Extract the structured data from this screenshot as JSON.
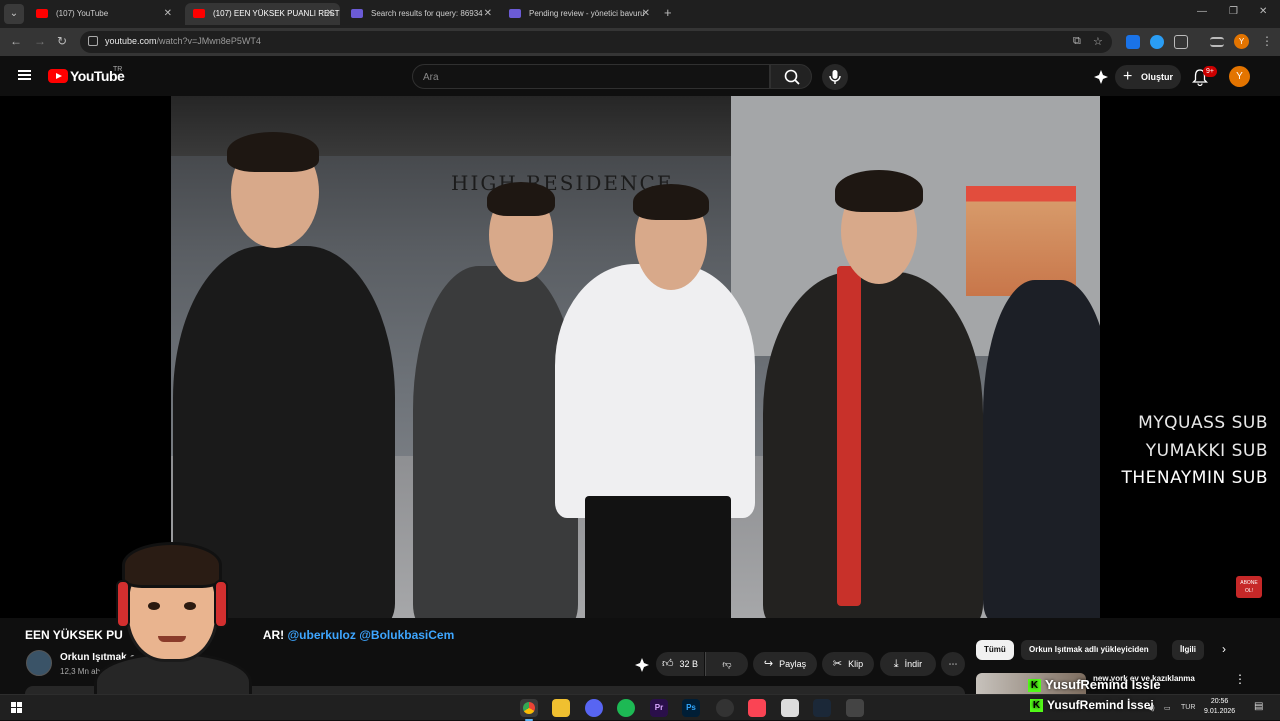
{
  "browser": {
    "tabs": [
      {
        "title": "(107) YouTube",
        "favicon": "youtube-icon",
        "active": false
      },
      {
        "title": "(107) EEN YÜKSEK PUANLI REST",
        "favicon": "youtube-icon",
        "active": true
      },
      {
        "title": "Search results for query: 86934",
        "favicon": "extension-icon",
        "active": false
      },
      {
        "title": "Pending review - yönetici bavuru",
        "favicon": "extension-icon",
        "active": false
      }
    ],
    "new_tab_label": "+",
    "url_host": "youtube.com",
    "url_path": "/watch?v=JMwn8eP5WT4"
  },
  "youtube": {
    "logo_text": "YouTube",
    "region": "TR",
    "search_placeholder": "Ara",
    "create_label": "Oluştur",
    "notifications_badge": "9+",
    "avatar_letter": "Y"
  },
  "player": {
    "ticker": [
      "MYQUASS  SUB",
      "YUMAKKI  SUB",
      "THENAYMIN  SUB"
    ],
    "store_sign": "HIGH RESIDENCE",
    "subscribe_overlay": "ABONE OL!"
  },
  "video": {
    "title_prefix": "EEN YÜKSEK PU",
    "title_suffix": "AR!",
    "mention_1": "@uberkuloz",
    "mention_2": "@BolukbasiCem",
    "channel_name": "Orkun Işıtmak",
    "channel_subs": "12,3 Mn abone",
    "like_count": "32 B",
    "share_label": "Paylaş",
    "clip_label": "Klip",
    "download_label": "İndir"
  },
  "sidebar": {
    "chips": [
      "Tümü",
      "Orkun Işıtmak adlı yükleyiciden",
      "İlgili"
    ],
    "rec_title": "new york ev ve kazıklanma"
  },
  "overlay": {
    "watermark_1": "YusufRemind İssle",
    "watermark_2": "YusufRemind İssei"
  },
  "taskbar": {
    "language": "TUR",
    "time": "20:56",
    "date": "9.01.2026",
    "apps": [
      "chrome",
      "files",
      "discord",
      "spotify",
      "Pr",
      "Ps",
      "obs",
      "valorant",
      "notes",
      "steam",
      "app"
    ]
  },
  "colors": {
    "accent_red": "#ff0000",
    "mention_blue": "#3ea6ff",
    "profile_orange": "#e37400"
  }
}
